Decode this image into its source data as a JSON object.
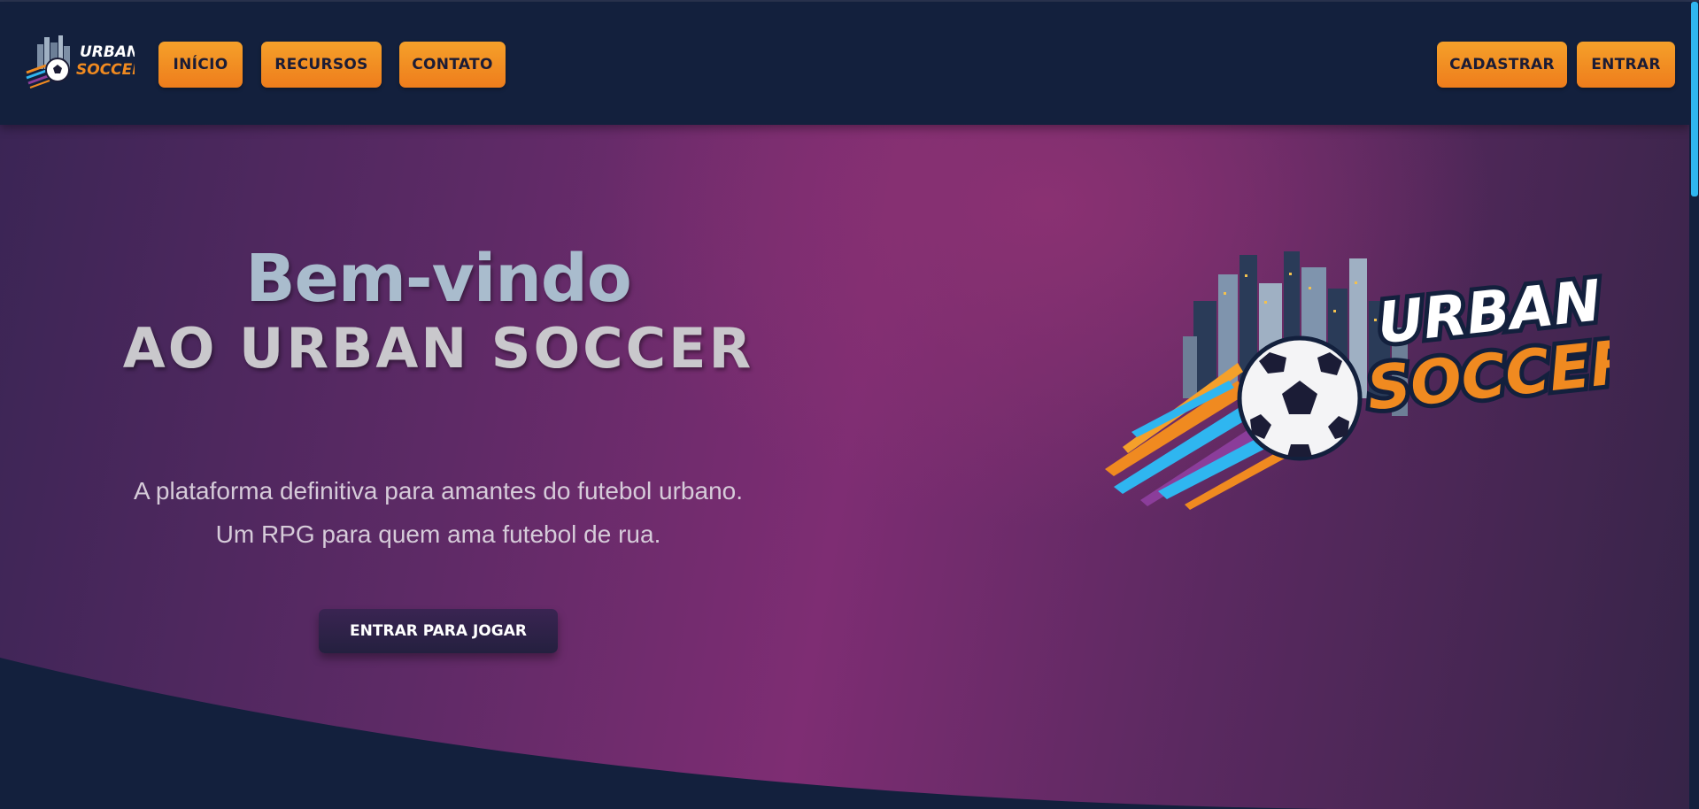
{
  "nav": {
    "logo_text_top": "URBAN",
    "logo_text_bottom": "SOCCER",
    "links": [
      {
        "label": "INÍCIO"
      },
      {
        "label": "RECURSOS"
      },
      {
        "label": "CONTATO"
      }
    ],
    "signup_label": "CADASTRAR",
    "login_label": "ENTRAR"
  },
  "hero": {
    "title_line1": "Bem-vindo",
    "title_line2": "AO URBAN SOCCER",
    "subtitle": "A plataforma definitiva para amantes do futebol urbano. Um RPG para quem ama futebol de rua.",
    "cta_label": "ENTRAR PARA JOGAR",
    "logo_text_top": "URBAN",
    "logo_text_bottom": "SOCCER"
  },
  "colors": {
    "navy": "#13203d",
    "orange": "#f08a20",
    "purple": "#7e2d73",
    "accent_blue": "#2fb6f0"
  }
}
